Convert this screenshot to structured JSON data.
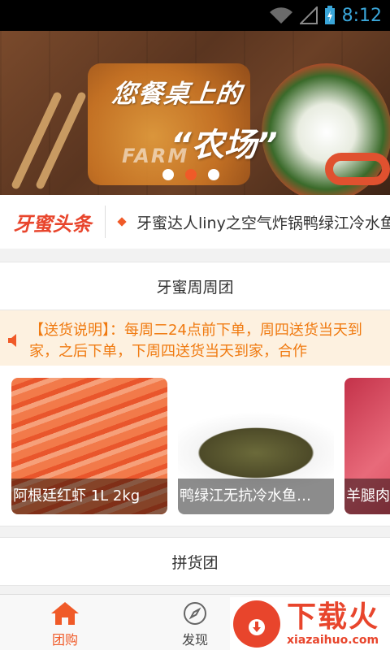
{
  "status_bar": {
    "time": "8:12"
  },
  "banner": {
    "headline": "您餐桌上的",
    "farm_word": "FARM",
    "title": "“农场”",
    "slide_count": 3,
    "active_slide": 2
  },
  "news": {
    "logo_text": "牙蜜头条",
    "headline": "牙蜜达人liny之空气炸锅鸭绿江冷水鱼"
  },
  "section_weekly": {
    "title": "牙蜜周周团"
  },
  "notice": {
    "text": "【送货说明】：每周二24点前下单，周四送货当天到家，之后下单，下周四送货当天到家，合作"
  },
  "products": [
    {
      "name": "阿根廷红虾 1L 2kg",
      "image": "shrimp"
    },
    {
      "name": "鸭绿江无抗冷水鱼…",
      "image": "fish"
    },
    {
      "name": "羊腿肉",
      "image": "meat"
    }
  ],
  "section_group": {
    "title": "拼货团"
  },
  "bottom_nav": {
    "tabs": [
      {
        "label": "团购",
        "icon": "home-icon",
        "active": true
      },
      {
        "label": "发现",
        "icon": "compass-icon",
        "active": false
      }
    ]
  },
  "watermark": {
    "brand": "下载火",
    "url": "xiazaihuo.com"
  },
  "colors": {
    "accent": "#f05a28",
    "notice_text": "#f07a10",
    "notice_bg": "#fdf1e0"
  }
}
